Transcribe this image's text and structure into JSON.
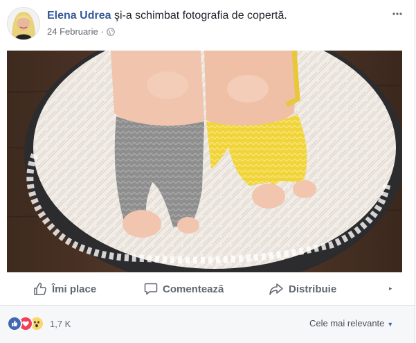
{
  "post": {
    "author": "Elena Udrea",
    "action_text": "şi-a schimbat fotografia de copertă.",
    "date": "24 Februarie",
    "date_separator": "·",
    "privacy_icon": "globe-icon",
    "more_icon": "more-options-icon"
  },
  "photo": {
    "alt": "cover-photo"
  },
  "actions": {
    "like_label": "Îmi place",
    "comment_label": "Comentează",
    "share_label": "Distribuie",
    "caret": "▸"
  },
  "footer": {
    "reaction_count": "1,7 K",
    "sort_label": "Cele mai relevante",
    "sort_caret": "▼",
    "reaction_icons": [
      "like-reaction-icon",
      "love-reaction-icon",
      "wow-reaction-icon"
    ]
  },
  "colors": {
    "author_link": "#365899",
    "like_blue": "#4267b2",
    "love_red": "#f33e58",
    "wow_yellow": "#fcd669",
    "secondary_text": "#606770"
  }
}
